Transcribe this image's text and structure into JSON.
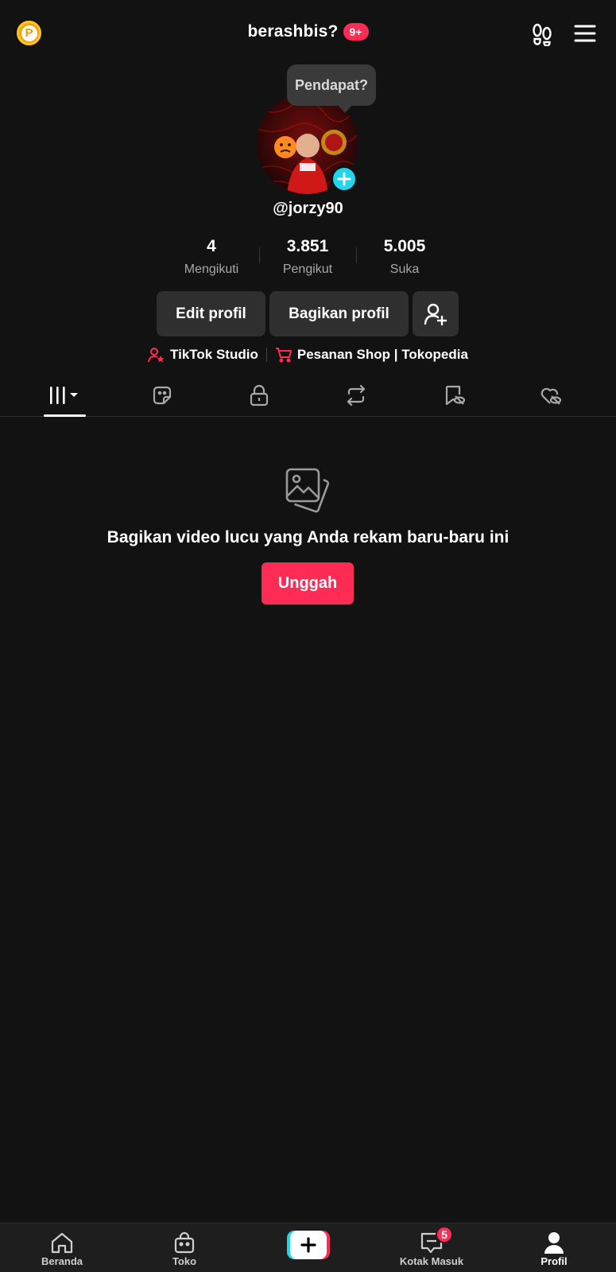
{
  "header": {
    "coin_letter": "P",
    "title": "berashbis?",
    "notif_badge": "9+"
  },
  "profile": {
    "tooltip": "Pendapat?",
    "username": "@jorzy90",
    "stats": [
      {
        "value": "4",
        "label": "Mengikuti"
      },
      {
        "value": "3.851",
        "label": "Pengikut"
      },
      {
        "value": "5.005",
        "label": "Suka"
      }
    ],
    "buttons": {
      "edit": "Edit profil",
      "share": "Bagikan profil"
    },
    "links": {
      "studio": "TikTok Studio",
      "shop": "Pesanan Shop | Tokopedia"
    }
  },
  "tabs": [
    "videos-grid",
    "stickers",
    "private",
    "reposts",
    "favorites",
    "liked"
  ],
  "empty_state": {
    "message": "Bagikan video lucu yang Anda rekam baru-baru ini",
    "upload_label": "Unggah"
  },
  "bottom_nav": {
    "home": "Beranda",
    "shop": "Toko",
    "inbox": "Kotak Masuk",
    "inbox_badge": "5",
    "profile": "Profil"
  },
  "colors": {
    "background": "#121212",
    "accent": "#fe2c55",
    "cyan": "#20d5ec",
    "button_bg": "#2f2f2f"
  }
}
